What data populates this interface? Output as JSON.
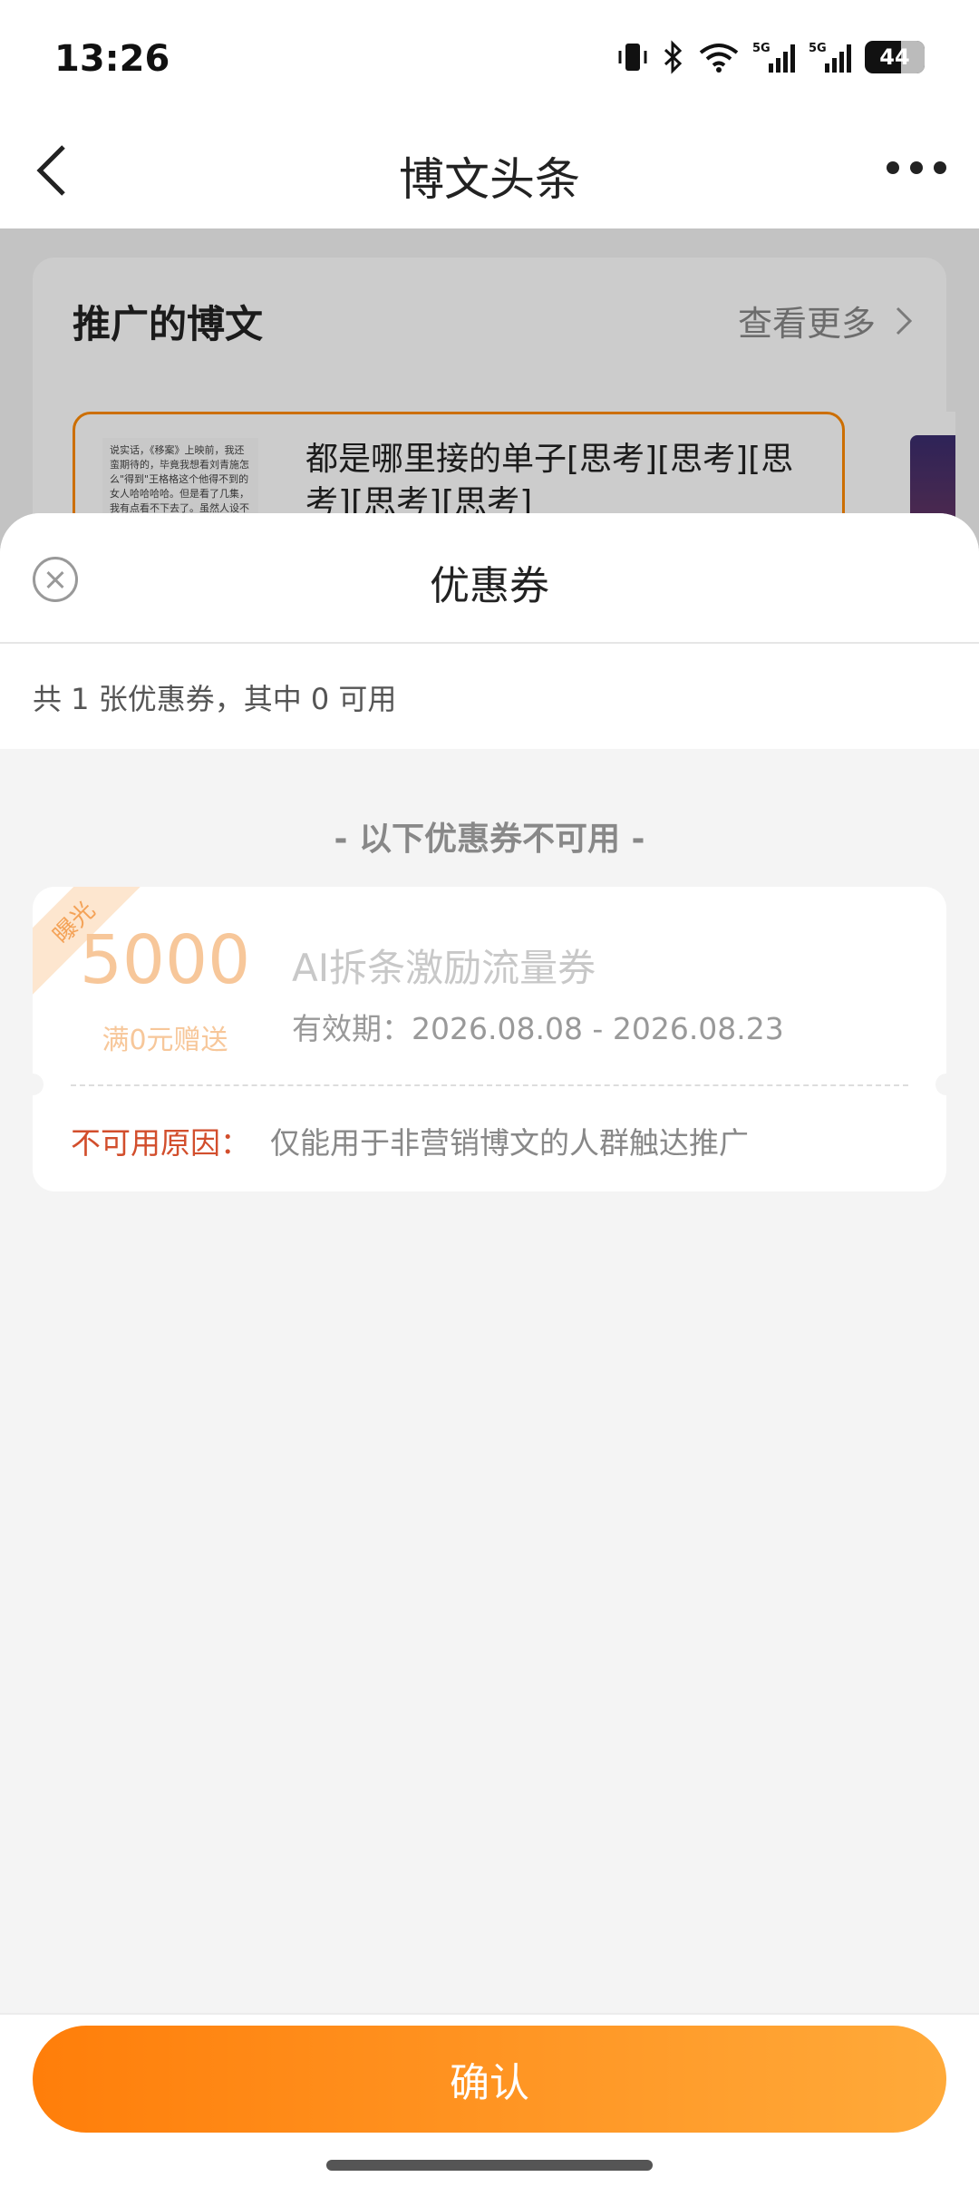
{
  "status_bar": {
    "time": "13:26",
    "battery": "44"
  },
  "nav": {
    "title": "博文头条"
  },
  "promo": {
    "header": "推广的博文",
    "more_label": "查看更多",
    "post_title": "都是哪里接的单子[思考][思考][思考][思考][思考]",
    "thumb_text": "说实话，《移案》上映前，我还蛮期待的，毕竟我想看刘青施怎么\"得到\"王格格这个他得不到的女人哈哈哈哈。但是看了几集，我有点看不下去了。虽然人设不一样，但可能因为诶造套"
  },
  "sheet": {
    "title": "优惠券",
    "summary": "共 1 张优惠券，其中 0 可用",
    "unavailable_header": "- 以下优惠券不可用 -"
  },
  "coupon": {
    "ribbon": "曝光",
    "amount": "5000",
    "condition": "满0元赠送",
    "name": "AI拆条激励流量券",
    "validity": "有效期：2026.08.08 - 2026.08.23",
    "reason_label": "不可用原因：",
    "reason_text": "仅能用于非营销博文的人群触达推广"
  },
  "footer": {
    "confirm_label": "确认"
  },
  "colors": {
    "accent": "#ff8a00",
    "reason": "#d24e2c"
  }
}
